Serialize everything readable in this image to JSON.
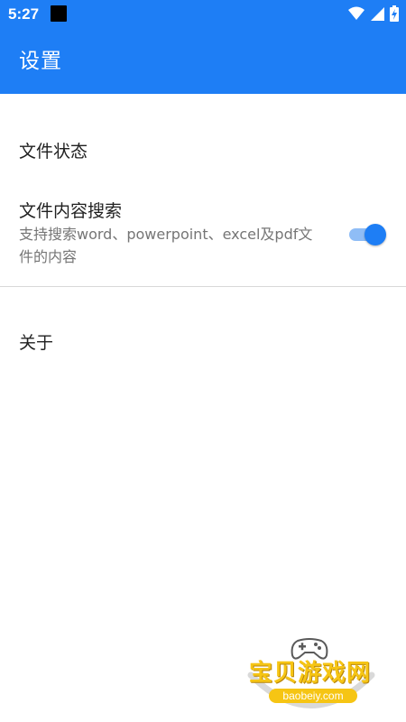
{
  "status_bar": {
    "time": "5:27",
    "icons": [
      "app-notification-icon",
      "wifi-icon",
      "cellular-signal-icon",
      "battery-charging-icon"
    ]
  },
  "app_bar": {
    "title": "设置"
  },
  "settings": {
    "file_status": {
      "title": "文件状态"
    },
    "content_search": {
      "title": "文件内容搜索",
      "summary": "支持搜索word、powerpoint、excel及pdf文件的内容",
      "enabled": true
    },
    "about": {
      "title": "关于"
    }
  },
  "watermark": {
    "brand": "宝贝游戏网",
    "url": "baobeiy.com"
  },
  "colors": {
    "primary": "#1e7ef5",
    "switch_track": "#8fbdf6",
    "title_text": "#212121",
    "summary_text": "#757575",
    "watermark_yellow": "#f6c514"
  }
}
